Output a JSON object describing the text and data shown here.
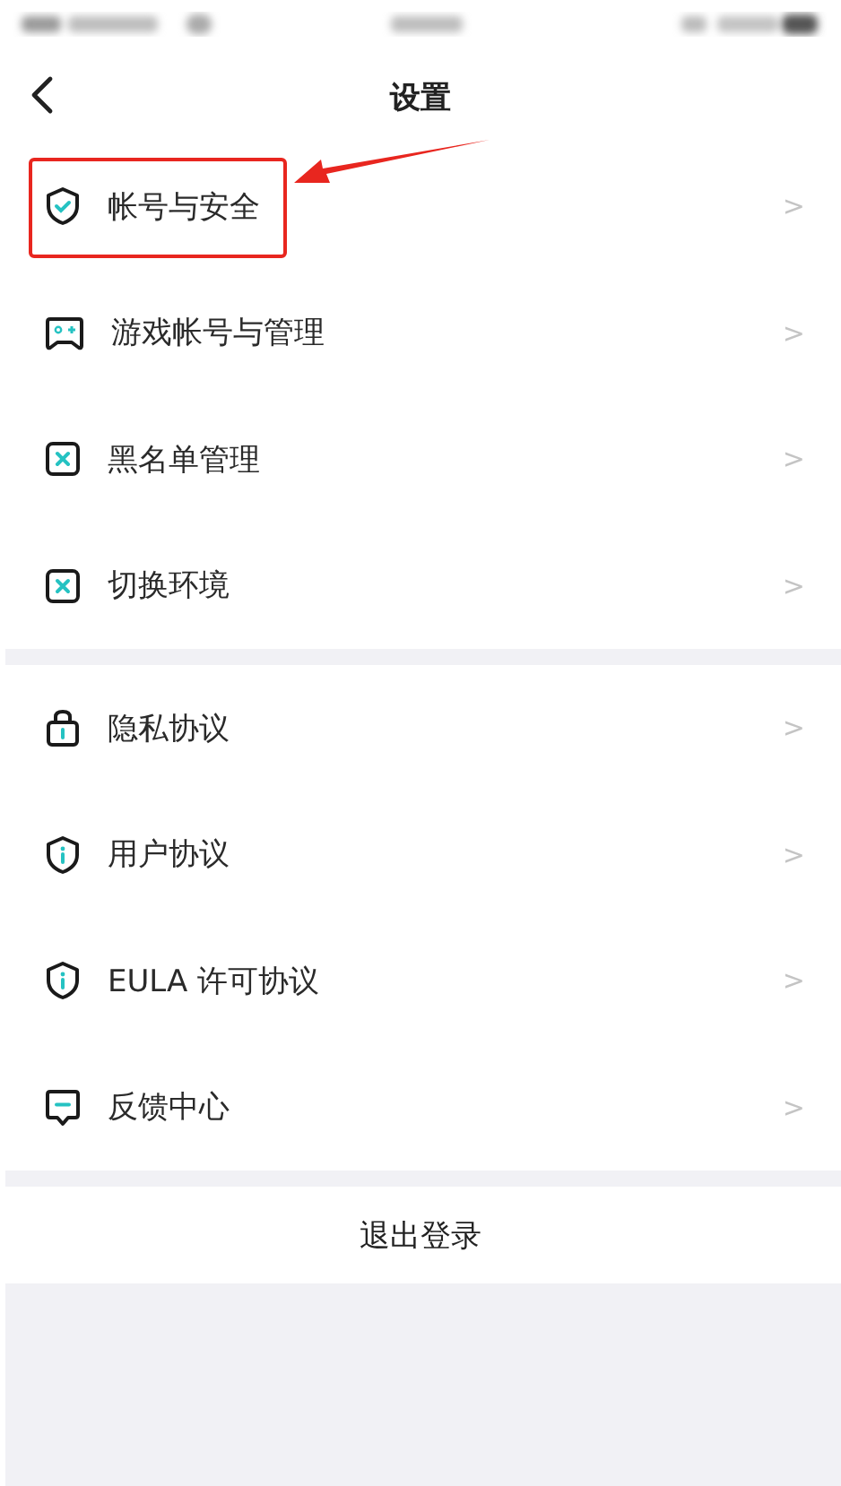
{
  "header": {
    "title": "设置"
  },
  "sections": [
    {
      "items": [
        {
          "label": "帐号与安全",
          "chevron": ">",
          "highlighted": true
        },
        {
          "label": "游戏帐号与管理",
          "chevron": ">",
          "highlighted": false
        },
        {
          "label": "黑名单管理",
          "chevron": ">",
          "highlighted": false
        },
        {
          "label": "切换环境",
          "chevron": ">",
          "highlighted": false
        }
      ]
    },
    {
      "items": [
        {
          "label": "隐私协议",
          "chevron": ">",
          "highlighted": false
        },
        {
          "label": "用户协议",
          "chevron": ">",
          "highlighted": false
        },
        {
          "label": "EULA 许可协议",
          "chevron": ">",
          "highlighted": false
        },
        {
          "label": "反馈中心",
          "chevron": ">",
          "highlighted": false
        }
      ]
    }
  ],
  "logout": {
    "label": "退出登录"
  }
}
